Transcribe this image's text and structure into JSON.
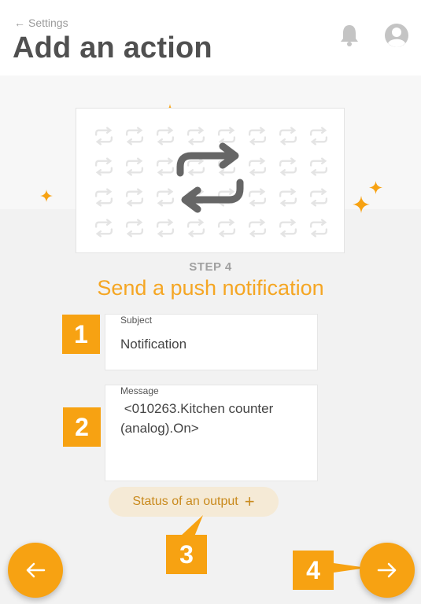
{
  "header": {
    "back_label": "Settings",
    "title": "Add an action",
    "icons": [
      "arrow-left-icon",
      "bell-icon",
      "user-icon"
    ]
  },
  "step": {
    "label": "STEP 4",
    "title": "Send a push notification"
  },
  "form": {
    "subject": {
      "label": "Subject",
      "value": "Notification"
    },
    "message": {
      "label": "Message",
      "value": " <010263.Kitchen counter (analog).On>"
    }
  },
  "status_chip": {
    "label": "Status of an output",
    "icon": "plus-icon"
  },
  "callouts": [
    "1",
    "2",
    "3",
    "4"
  ],
  "navigation": {
    "prev_icon": "arrow-left-icon",
    "next_icon": "arrow-right-icon"
  },
  "colors": {
    "accent": "#f7a212",
    "title_orange": "#f5a623",
    "chip_bg": "#f5ead6",
    "chip_text": "#c98a1d",
    "header_text": "#505050"
  }
}
